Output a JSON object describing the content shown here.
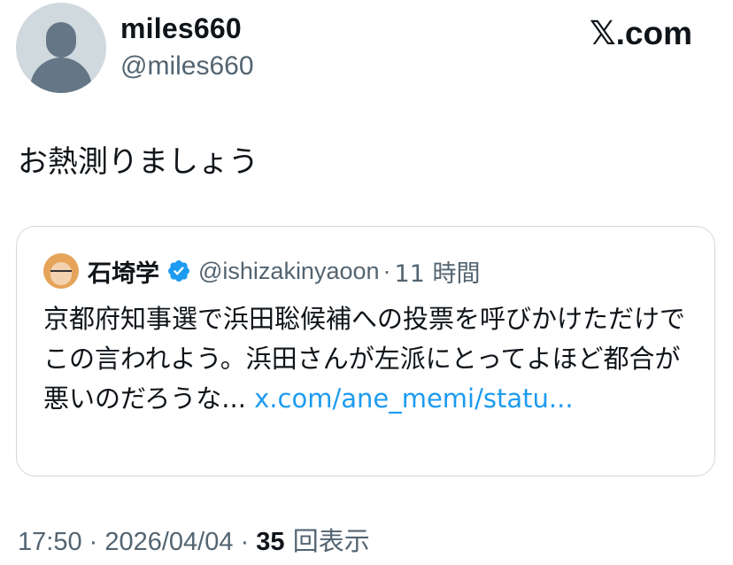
{
  "author": {
    "display_name": "miles660",
    "handle": "@miles660"
  },
  "logo": "𝕏.com",
  "tweet": {
    "text": "お熱測りましょう"
  },
  "quote": {
    "name": "石埼学",
    "handle": "@ishizakinyaoon",
    "separator": "·",
    "time": "11 時間",
    "verified_icon": "verified-badge-icon",
    "text": "京都府知事選で浜田聡候補への投票を呼びかけただけでこの言われよう。浜田さんが左派にとってよほど都合が悪いのだろうな... ",
    "link": "x.com/ane_memi/statu..."
  },
  "meta": {
    "time": "17:50",
    "sep1": " · ",
    "date": "2026/04/04",
    "sep2": " · ",
    "views": "35",
    "views_label": " 回表示"
  },
  "colors": {
    "link": "#1d9bf0",
    "secondary": "#536471",
    "primary": "#0f1419",
    "border": "#cfd9de",
    "verified": "#1d9bf0"
  }
}
